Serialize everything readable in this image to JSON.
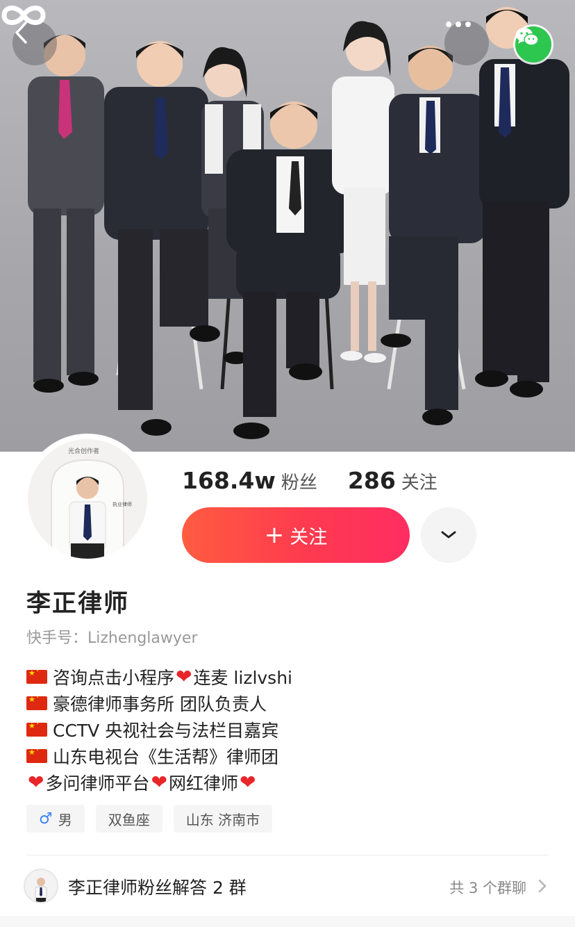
{
  "header": {
    "back_icon": "chevron-left-icon",
    "more_icon": "more-horizontal-icon",
    "share_icon": "wechat-icon",
    "cover_overlay_icon": "infinity-icon",
    "cover_description": "team photo"
  },
  "profile": {
    "avatar_badge": "光合创作者",
    "stats": {
      "followers_count": "168.4w",
      "followers_label": "粉丝",
      "following_count": "286",
      "following_label": "关注"
    },
    "follow_button": {
      "plus": "+",
      "label": "关注"
    },
    "more_button_icon": "chevron-down-icon",
    "name": "李正律师",
    "kuaishou_id": "快手号：Lizhenglawyer"
  },
  "bio": {
    "lines": [
      {
        "flag": true,
        "parts": [
          "咨询点击小程序",
          "❤",
          "连麦 lizlvshi"
        ]
      },
      {
        "flag": true,
        "parts": [
          "豪德律师事务所 团队负责人"
        ]
      },
      {
        "flag": true,
        "parts": [
          "CCTV 央视社会与法栏目嘉宾"
        ]
      },
      {
        "flag": true,
        "parts": [
          "山东电视台《生活帮》律师团"
        ]
      },
      {
        "flag": false,
        "parts": [
          "❤",
          "多问律师平台",
          "❤",
          "网红律师",
          "❤"
        ]
      }
    ]
  },
  "tags": [
    {
      "icon": "♂",
      "label": "男"
    },
    {
      "label": "双鱼座"
    },
    {
      "label": "山东 济南市"
    }
  ],
  "group_chat": {
    "name": "李正律师粉丝解答 2 群",
    "count_text": "共 3 个群聊",
    "chevron_icon": "chevron-right-icon"
  },
  "colors": {
    "follow_gradient_start": "#fe5c40",
    "follow_gradient_end": "#ff2d62",
    "wechat_green": "#2dc64f",
    "heart_red": "#e8262a"
  }
}
